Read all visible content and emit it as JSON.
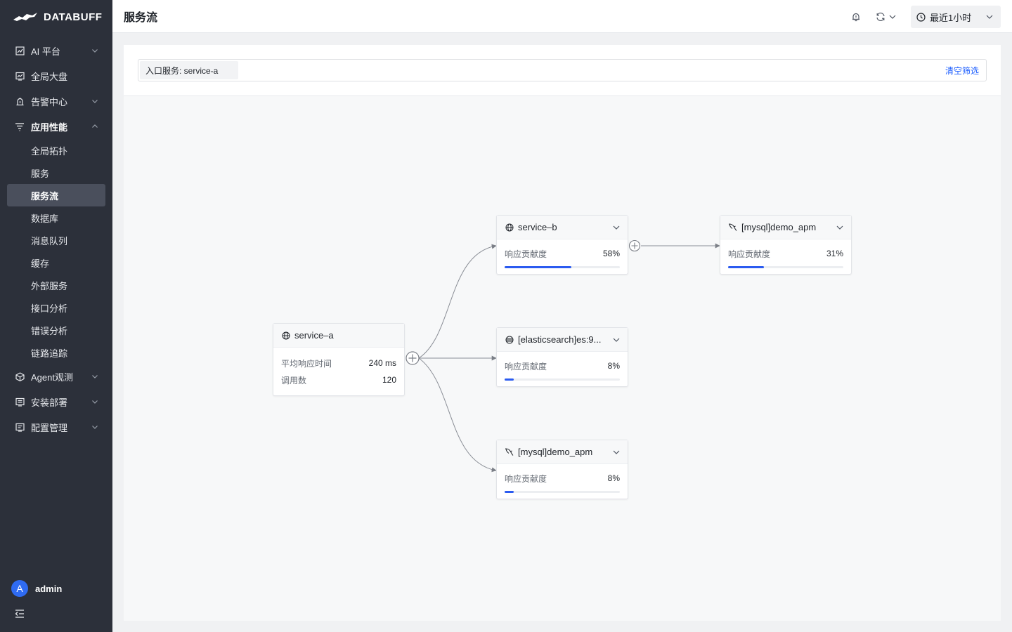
{
  "brand": {
    "name": "DATABUFF"
  },
  "sidebar": {
    "items": [
      {
        "label": "AI 平台",
        "icon": "chart-icon",
        "has_arrow": true
      },
      {
        "label": "全局大盘",
        "icon": "dashboard-icon",
        "has_arrow": false
      },
      {
        "label": "告警中心",
        "icon": "alarm-icon",
        "has_arrow": true
      },
      {
        "label": "应用性能",
        "icon": "filter-lines-icon",
        "has_arrow": true,
        "expanded": true
      }
    ],
    "sub_items": [
      {
        "label": "全局拓扑"
      },
      {
        "label": "服务"
      },
      {
        "label": "服务流",
        "active": true
      },
      {
        "label": "数据库"
      },
      {
        "label": "消息队列"
      },
      {
        "label": "缓存"
      },
      {
        "label": "外部服务"
      },
      {
        "label": "接口分析"
      },
      {
        "label": "错误分析"
      },
      {
        "label": "链路追踪"
      }
    ],
    "bottom_items": [
      {
        "label": "Agent观测",
        "icon": "cube-icon"
      },
      {
        "label": "安装部署",
        "icon": "list-icon"
      },
      {
        "label": "配置管理",
        "icon": "settings-list-icon"
      }
    ],
    "user": {
      "initial": "A",
      "name": "admin"
    }
  },
  "header": {
    "title": "服务流",
    "time_range": "最近1小时"
  },
  "filter": {
    "tag": "入口服务: service-a",
    "clear": "清空筛选"
  },
  "graph": {
    "root": {
      "name": "service–a",
      "icon": "globe-icon",
      "avg_label": "平均响应时间",
      "avg_value": "240 ms",
      "calls_label": "调用数",
      "calls_value": "120"
    },
    "nodes": [
      {
        "id": "b",
        "name": "service–b",
        "icon": "globe-icon",
        "metric_label": "响应贡献度",
        "metric_value": "58%",
        "fill": 0.58
      },
      {
        "id": "es",
        "name": "[elasticsearch]es:9...",
        "icon": "elasticsearch-icon",
        "metric_label": "响应贡献度",
        "metric_value": "8%",
        "fill": 0.08
      },
      {
        "id": "mysql1",
        "name": "[mysql]demo_apm",
        "icon": "mysql-icon",
        "metric_label": "响应贡献度",
        "metric_value": "8%",
        "fill": 0.08
      },
      {
        "id": "mysql2",
        "name": "[mysql]demo_apm",
        "icon": "mysql-icon",
        "metric_label": "响应贡献度",
        "metric_value": "31%",
        "fill": 0.31
      }
    ]
  },
  "colors": {
    "accent": "#2b5bf0",
    "link": "#1a5cff",
    "sidebar": "#2c303a"
  }
}
